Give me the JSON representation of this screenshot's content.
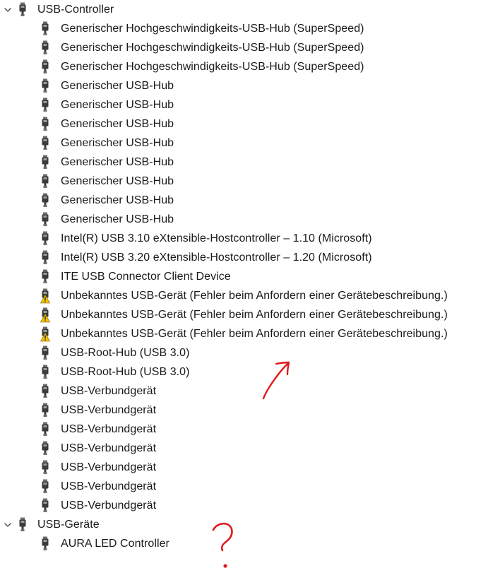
{
  "tree": [
    {
      "label": "USB-Controller",
      "icon": "usb-plug-icon",
      "expanded": true,
      "children": [
        {
          "label": "Generischer Hochgeschwindigkeits-USB-Hub (SuperSpeed)",
          "icon": "usb-plug-icon",
          "warning": false
        },
        {
          "label": "Generischer Hochgeschwindigkeits-USB-Hub (SuperSpeed)",
          "icon": "usb-plug-icon",
          "warning": false
        },
        {
          "label": "Generischer Hochgeschwindigkeits-USB-Hub (SuperSpeed)",
          "icon": "usb-plug-icon",
          "warning": false
        },
        {
          "label": "Generischer USB-Hub",
          "icon": "usb-plug-icon",
          "warning": false
        },
        {
          "label": "Generischer USB-Hub",
          "icon": "usb-plug-icon",
          "warning": false
        },
        {
          "label": "Generischer USB-Hub",
          "icon": "usb-plug-icon",
          "warning": false
        },
        {
          "label": "Generischer USB-Hub",
          "icon": "usb-plug-icon",
          "warning": false
        },
        {
          "label": "Generischer USB-Hub",
          "icon": "usb-plug-icon",
          "warning": false
        },
        {
          "label": "Generischer USB-Hub",
          "icon": "usb-plug-icon",
          "warning": false
        },
        {
          "label": "Generischer USB-Hub",
          "icon": "usb-plug-icon",
          "warning": false
        },
        {
          "label": "Generischer USB-Hub",
          "icon": "usb-plug-icon",
          "warning": false
        },
        {
          "label": "Intel(R) USB 3.10 eXtensible-Hostcontroller – 1.10 (Microsoft)",
          "icon": "usb-plug-icon",
          "warning": false
        },
        {
          "label": "Intel(R) USB 3.20 eXtensible-Hostcontroller – 1.20 (Microsoft)",
          "icon": "usb-plug-icon",
          "warning": false
        },
        {
          "label": "ITE USB Connector Client Device",
          "icon": "usb-plug-icon",
          "warning": false
        },
        {
          "label": "Unbekanntes USB-Gerät (Fehler beim Anfordern einer Gerätebeschreibung.)",
          "icon": "usb-plug-icon",
          "warning": true
        },
        {
          "label": "Unbekanntes USB-Gerät (Fehler beim Anfordern einer Gerätebeschreibung.)",
          "icon": "usb-plug-icon",
          "warning": true
        },
        {
          "label": "Unbekanntes USB-Gerät (Fehler beim Anfordern einer Gerätebeschreibung.)",
          "icon": "usb-plug-icon",
          "warning": true
        },
        {
          "label": "USB-Root-Hub (USB 3.0)",
          "icon": "usb-plug-icon",
          "warning": false
        },
        {
          "label": "USB-Root-Hub (USB 3.0)",
          "icon": "usb-plug-icon",
          "warning": false
        },
        {
          "label": "USB-Verbundgerät",
          "icon": "usb-plug-icon",
          "warning": false
        },
        {
          "label": "USB-Verbundgerät",
          "icon": "usb-plug-icon",
          "warning": false
        },
        {
          "label": "USB-Verbundgerät",
          "icon": "usb-plug-icon",
          "warning": false
        },
        {
          "label": "USB-Verbundgerät",
          "icon": "usb-plug-icon",
          "warning": false
        },
        {
          "label": "USB-Verbundgerät",
          "icon": "usb-plug-icon",
          "warning": false
        },
        {
          "label": "USB-Verbundgerät",
          "icon": "usb-plug-icon",
          "warning": false
        },
        {
          "label": "USB-Verbundgerät",
          "icon": "usb-plug-icon",
          "warning": false
        }
      ]
    },
    {
      "label": "USB-Geräte",
      "icon": "usb-plug-icon",
      "expanded": true,
      "children": [
        {
          "label": "AURA LED Controller",
          "icon": "usb-plug-icon",
          "warning": false
        }
      ]
    }
  ],
  "annotations": {
    "arrow": "hand-drawn-red-arrow",
    "question_mark": "?",
    "ink_color": "#e0191b"
  },
  "colors": {
    "icon_dark": "#3b3b3b",
    "icon_mid": "#6e6e6e",
    "warning_yellow": "#f2c200",
    "chevron": "#444444"
  }
}
